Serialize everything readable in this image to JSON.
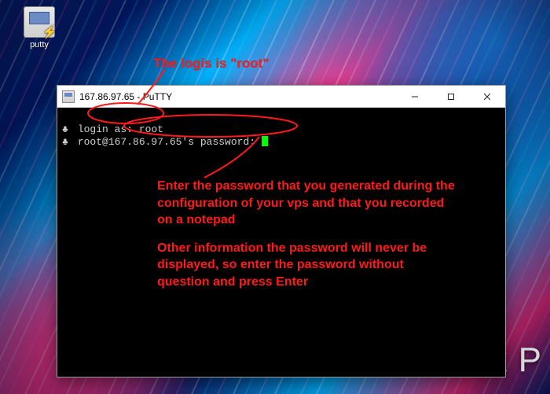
{
  "desktop": {
    "icon_label": "putty"
  },
  "window": {
    "title": "167.86.97.65 - PuTTY"
  },
  "terminal": {
    "line1_prompt": "login as:",
    "line1_value": "root",
    "line2_prompt": "root@167.86.97.65's password:"
  },
  "annotations": {
    "top": "The logis is \"root\"",
    "body_p1": "Enter the password that you generated during the configuration of your vps and that you recorded on a notepad",
    "body_p2": "Other information the password will never be displayed, so enter the password without question and press Enter"
  },
  "bg_text": "k P",
  "colors": {
    "annotation": "#ff1a1a",
    "cursor": "#00ff00"
  }
}
